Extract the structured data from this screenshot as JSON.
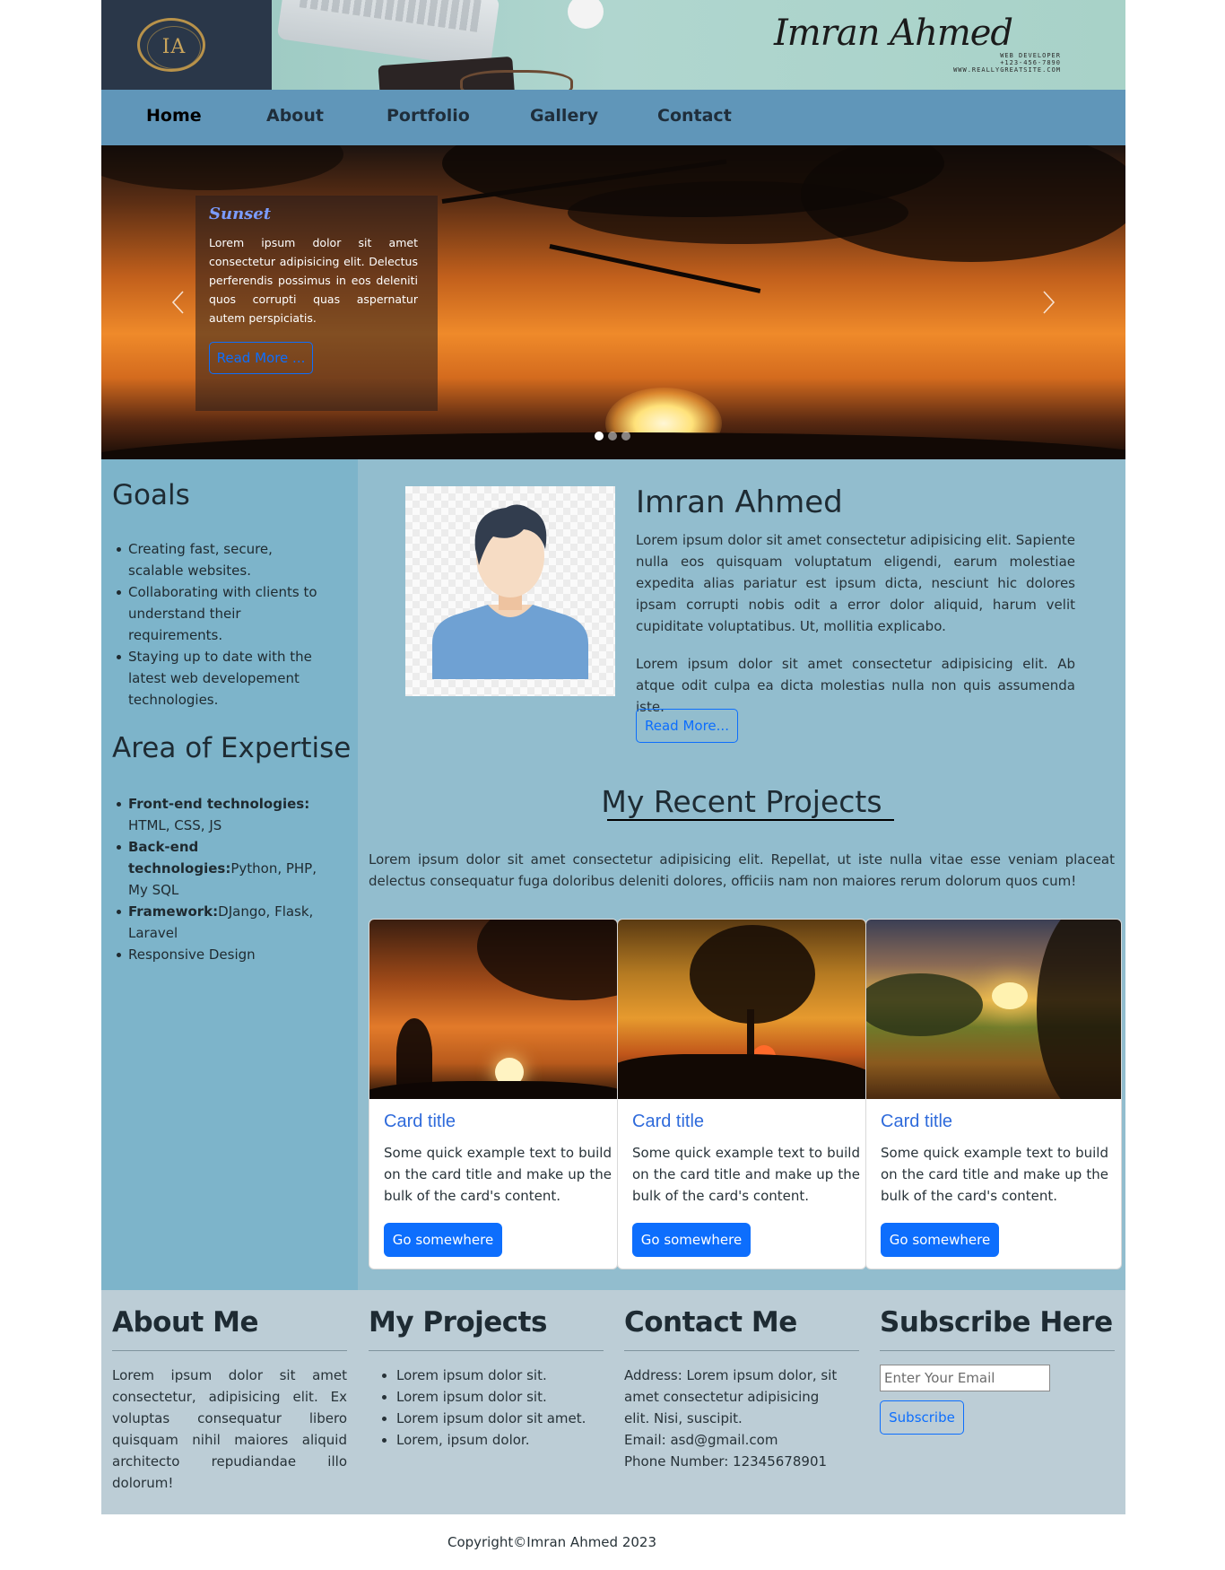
{
  "header": {
    "logo_letters": "IA",
    "logo_ring_text": "IMRAN AHMED",
    "signature": "Imran Ahmed",
    "signature_lines": [
      "WEB DEVELOPER",
      "+123-456-7890",
      "WWW.REALLYGREATSITE.COM"
    ]
  },
  "nav": {
    "items": [
      {
        "label": "Home",
        "active": true
      },
      {
        "label": "About"
      },
      {
        "label": "Portfolio"
      },
      {
        "label": "Gallery"
      },
      {
        "label": "Contact"
      }
    ]
  },
  "carousel": {
    "title": "Sunset",
    "text": "Lorem ipsum dolor sit amet consectetur adipisicing elit. Delectus perferendis possimus in eos deleniti quos corrupti quas aspernatur autem perspiciatis.",
    "button": "Read More ...",
    "slides": 3,
    "active_slide": 1
  },
  "sidebar": {
    "goals_title": "Goals",
    "goals": [
      "Creating fast, secure, scalable websites.",
      "Collaborating with clients to understand their requirements.",
      "Staying up to date with the latest web developement technologies."
    ],
    "expertise_title": "Area of Expertise",
    "expertise": [
      {
        "bold": "Front-end technologies:",
        "text": "HTML, CSS, JS"
      },
      {
        "bold": "Back-end technologies:",
        "text": "Python, PHP, My SQL"
      },
      {
        "bold": "Framework:",
        "text": "DJango, Flask, Laravel"
      },
      {
        "bold": "",
        "text": "Responsive Design"
      }
    ]
  },
  "profile": {
    "name": "Imran Ahmed",
    "p1": "Lorem ipsum dolor sit amet consectetur adipisicing elit. Sapiente nulla eos quisquam voluptatum eligendi, earum molestiae expedita alias pariatur est ipsum dicta, nesciunt hic dolores ipsam corrupti nobis odit a error dolor aliquid, harum velit cupiditate voluptatibus. Ut, mollitia explicabo.",
    "p2": "Lorem ipsum dolor sit amet consectetur adipisicing elit. Ab atque odit culpa ea dicta molestias nulla non quis assumenda iste.",
    "button": "Read More..."
  },
  "projects": {
    "title": "My Recent Projects",
    "intro": "Lorem ipsum dolor sit amet consectetur adipisicing elit. Repellat, ut iste nulla vitae esse veniam placeat delectus consequatur fuga doloribus deleniti dolores, officiis nam non maiores rerum dolorum quos cum!",
    "cards": [
      {
        "title": "Card title",
        "text": "Some quick example text to build on the card title and make up the bulk of the card's content.",
        "button": "Go somewhere"
      },
      {
        "title": "Card title",
        "text": "Some quick example text to build on the card title and make up the bulk of the card's content.",
        "button": "Go somewhere"
      },
      {
        "title": "Card title",
        "text": "Some quick example text to build on the card title and make up the bulk of the card's content.",
        "button": "Go somewhere"
      }
    ]
  },
  "footer": {
    "about_title": "About Me",
    "about_text": "Lorem ipsum dolor sit amet consectetur, adipisicing elit. Ex voluptas consequatur libero quisquam nihil maiores aliquid architecto repudiandae illo dolorum!",
    "projects_title": "My Projects",
    "projects": [
      "Lorem ipsum dolor sit.",
      "Lorem ipsum dolor sit.",
      "Lorem ipsum dolor sit amet.",
      "Lorem, ipsum dolor."
    ],
    "contact_title": "Contact Me",
    "contact_address": "Address: Lorem ipsum dolor, sit amet consectetur adipisicing elit. Nisi, suscipit.",
    "contact_email": "Email: asd@gmail.com",
    "contact_phone": "Phone Number: 12345678901",
    "subscribe_title": "Subscribe Here",
    "email_placeholder": "Enter Your Email",
    "subscribe_button": "Subscribe"
  },
  "copyright": "Copyright©Imran Ahmed 2023",
  "colors": {
    "nav_bg": "#6096b9",
    "sidebar_bg": "#7db4ca",
    "main_bg": "#92bdce",
    "footer_bg": "#bccdd6",
    "primary": "#0d6efd"
  }
}
